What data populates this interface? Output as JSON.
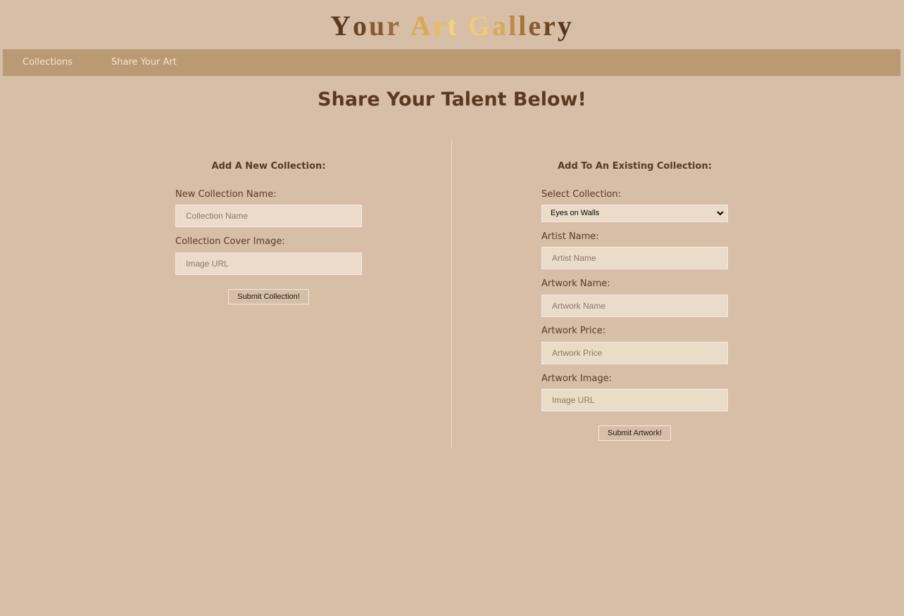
{
  "header": {
    "logo": {
      "letters": [
        {
          "ch": "Y",
          "color": "#5b3a1f"
        },
        {
          "ch": "o",
          "color": "#6e4522"
        },
        {
          "ch": "u",
          "color": "#8a5a2c"
        },
        {
          "ch": "r",
          "color": "#a06b34"
        },
        {
          "ch": " ",
          "color": "#a06b34"
        },
        {
          "ch": "A",
          "color": "#d9a94f"
        },
        {
          "ch": "r",
          "color": "#e8bd5d"
        },
        {
          "ch": "t",
          "color": "#f3d37a"
        },
        {
          "ch": " ",
          "color": "#f3d37a"
        },
        {
          "ch": "G",
          "color": "#efcb72"
        },
        {
          "ch": "a",
          "color": "#d9a956"
        },
        {
          "ch": "l",
          "color": "#c08a44"
        },
        {
          "ch": "l",
          "color": "#a87239"
        },
        {
          "ch": "e",
          "color": "#8b5c2f"
        },
        {
          "ch": "r",
          "color": "#6e4524"
        },
        {
          "ch": "y",
          "color": "#55351c"
        }
      ]
    }
  },
  "nav": {
    "items": [
      {
        "label": "Collections"
      },
      {
        "label": "Share Your Art"
      }
    ]
  },
  "page": {
    "title": "Share Your Talent Below!"
  },
  "new_collection": {
    "heading": "Add A New Collection:",
    "name_label": "New Collection Name:",
    "name_placeholder": "Collection Name",
    "cover_label": "Collection Cover Image:",
    "cover_placeholder": "Image URL",
    "submit_label": "Submit Collection!"
  },
  "existing_collection": {
    "heading": "Add To An Existing Collection:",
    "select_label": "Select Collection:",
    "selected_collection": "Eyes on Walls",
    "artist_label": "Artist Name:",
    "artist_placeholder": "Artist Name",
    "artwork_name_label": "Artwork Name:",
    "artwork_name_placeholder": "Artwork Name",
    "price_label": "Artwork Price:",
    "price_placeholder": "Artwork Price",
    "image_label": "Artwork Image:",
    "image_placeholder": "Image URL",
    "submit_label": "Submit Artwork!"
  },
  "colors": {
    "background": "#d6bea7",
    "navbar": "#b99a72",
    "nav_text": "#f2e6d6",
    "text": "#5a3a20",
    "input_bg": "#eadcc9"
  }
}
